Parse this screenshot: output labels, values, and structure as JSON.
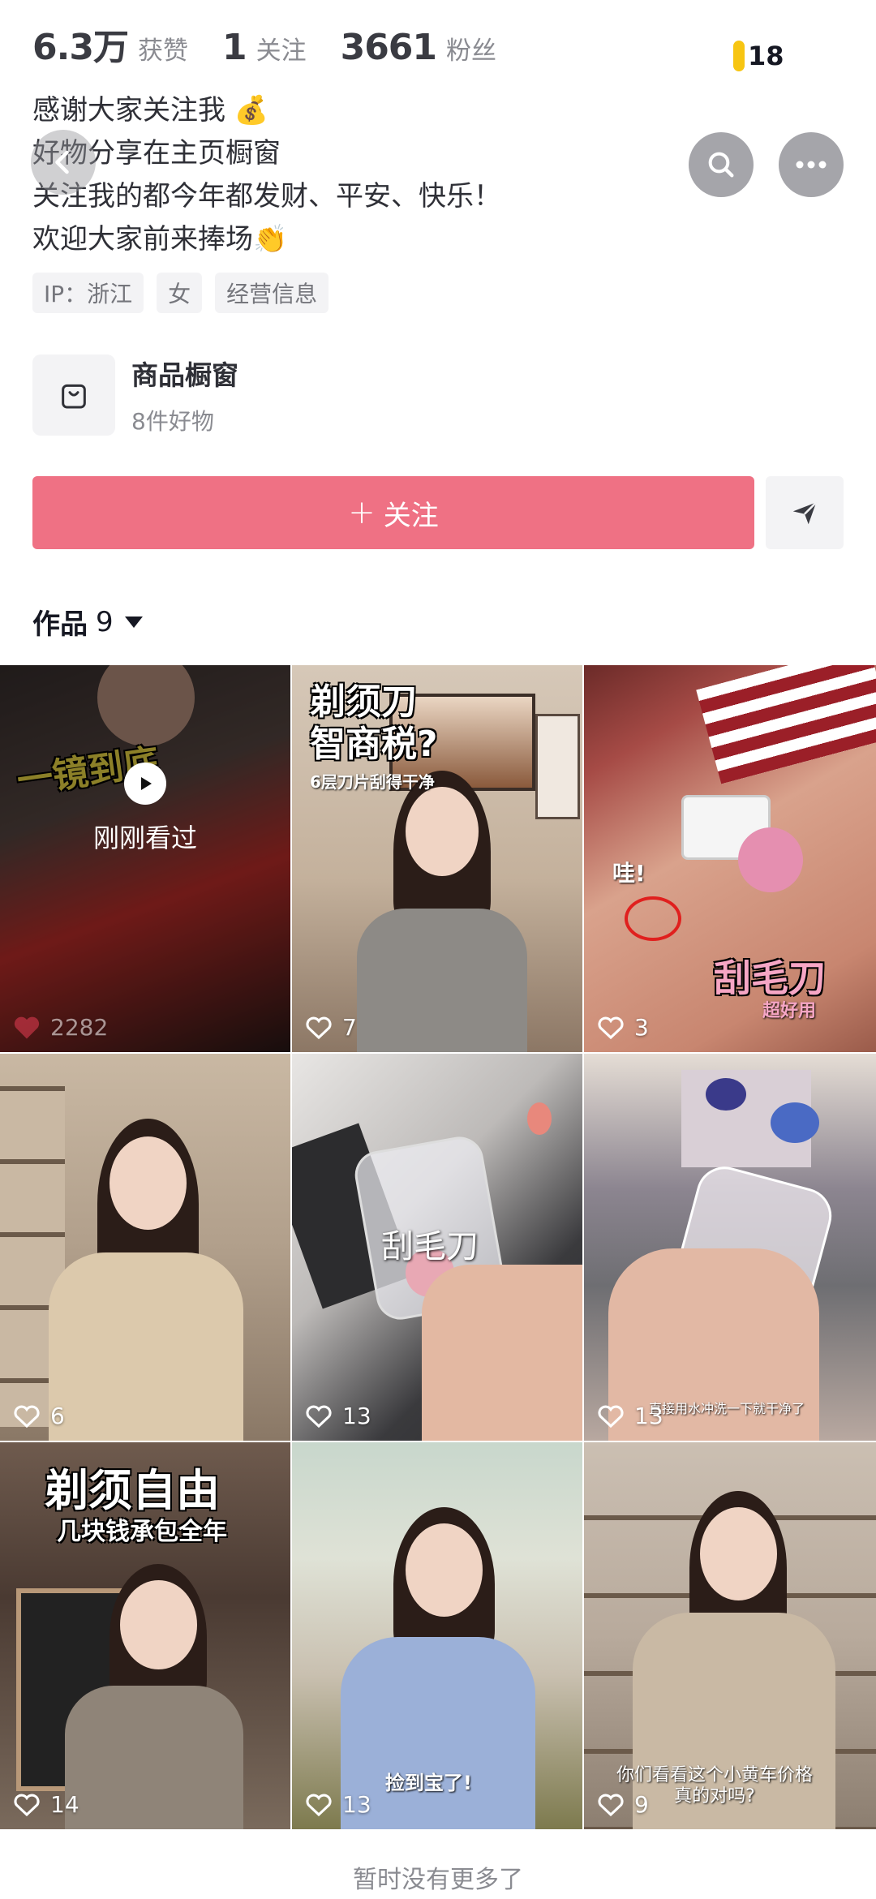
{
  "stats": [
    {
      "num": "6.3万",
      "label": "获赞"
    },
    {
      "num": "1",
      "label": "关注"
    },
    {
      "num": "3661",
      "label": "粉丝"
    }
  ],
  "notification_count": "18",
  "bio": {
    "lines": [
      "感谢大家关注我 💰",
      "好物分享在主页橱窗",
      "关注我的都今年都发财、平安、快乐！",
      "欢迎大家前来捧场👏"
    ]
  },
  "tags": [
    "IP：浙江",
    "女",
    "经营信息"
  ],
  "shop": {
    "title": "商品橱窗",
    "subtitle": "8件好物"
  },
  "follow_label": "关注",
  "works": {
    "label": "作品",
    "count": "9"
  },
  "videos": [
    {
      "likes": "2282",
      "watched_label": "刚刚看过",
      "caption": "一镜到底"
    },
    {
      "likes": "7",
      "caption": "剃须刀\n智商税?",
      "sub": "6层刀片刮得干净"
    },
    {
      "likes": "3",
      "caption": "刮毛刀",
      "sub": "超好用",
      "extra": "哇!"
    },
    {
      "likes": "6"
    },
    {
      "likes": "13",
      "caption": "刮毛刀"
    },
    {
      "likes": "13",
      "sub": "直接用水冲洗一下就干净了"
    },
    {
      "likes": "14",
      "caption": "剃须自由",
      "sub": "几块钱承包全年"
    },
    {
      "likes": "13",
      "sub": "捡到宝了!"
    },
    {
      "likes": "9",
      "sub": "你们看看这个小黄车价格\n真的对吗?"
    }
  ],
  "footer": "暂时没有更多了",
  "colors": {
    "accent": "#ef7184",
    "badge": "#f7c512"
  }
}
